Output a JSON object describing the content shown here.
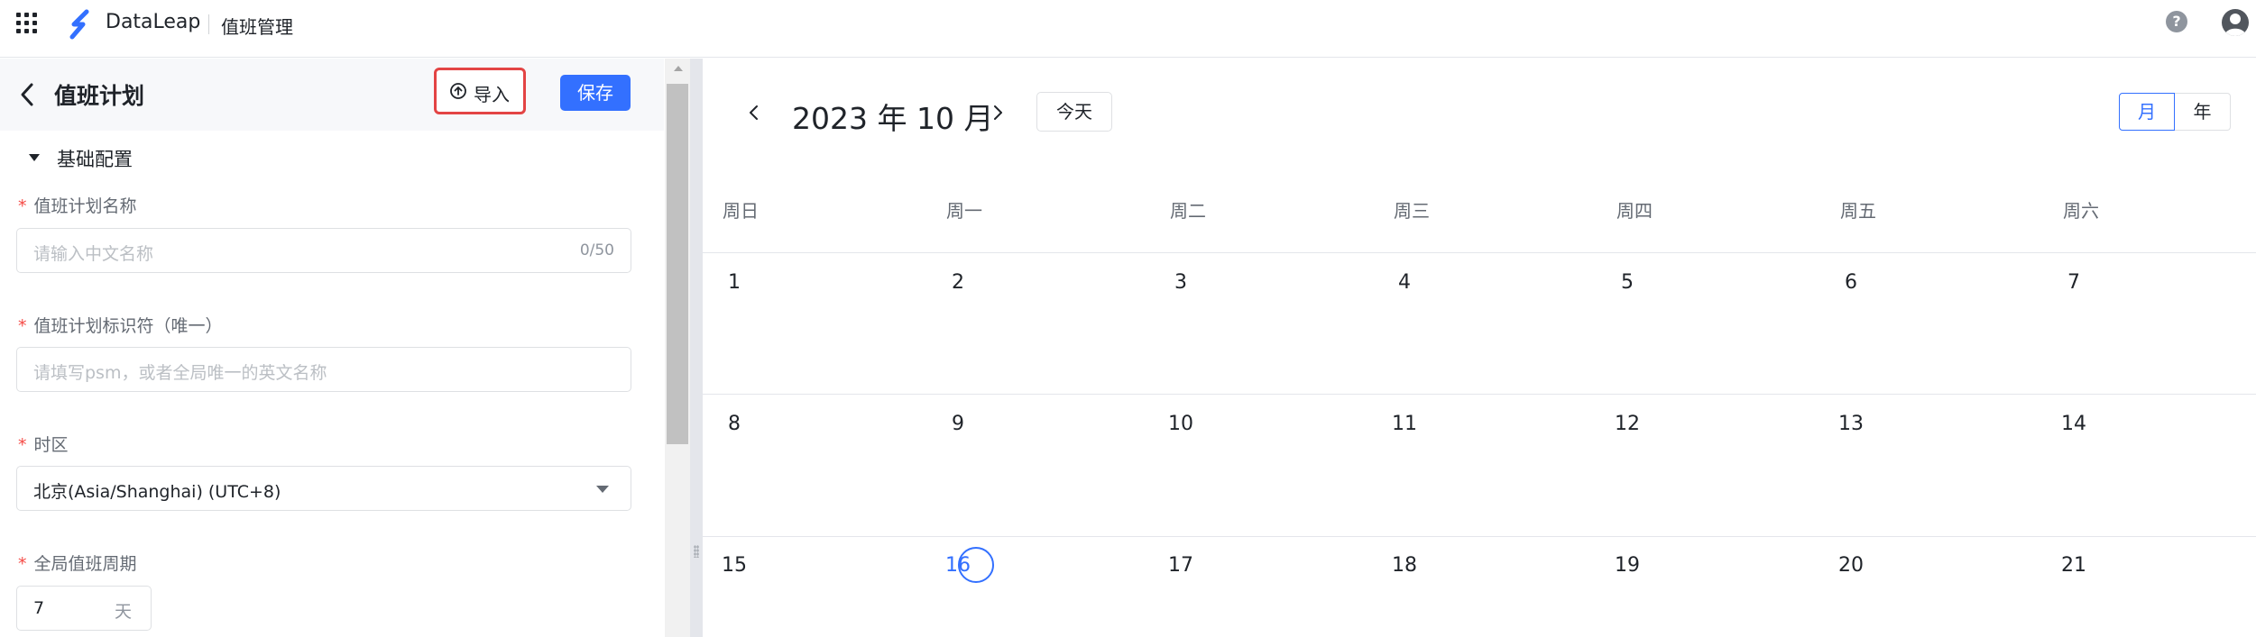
{
  "topbar": {
    "brand": "DataLeap",
    "module": "值班管理",
    "help_glyph": "?"
  },
  "plan": {
    "title": "值班计划",
    "import_label": "导入",
    "save_label": "保存",
    "section_title": "基础配置",
    "fields": {
      "name": {
        "label": "值班计划名称",
        "required_mark": "*",
        "placeholder": "请输入中文名称",
        "count": "0/50"
      },
      "identifier": {
        "label": "值班计划标识符（唯一）",
        "required_mark": "*",
        "placeholder": "请填写psm，或者全局唯一的英文名称"
      },
      "timezone": {
        "label": "时区",
        "required_mark": "*",
        "value": "北京(Asia/Shanghai) (UTC+8)"
      },
      "period": {
        "label": "全局值班周期",
        "required_mark": "*",
        "value": "7",
        "unit": "天"
      }
    }
  },
  "calendar": {
    "title": "2023 年 10 月",
    "today_label": "今天",
    "view_month": "月",
    "view_year": "年",
    "weekdays": [
      "周日",
      "周一",
      "周二",
      "周三",
      "周四",
      "周五",
      "周六"
    ],
    "weeks": [
      [
        "1",
        "2",
        "3",
        "4",
        "5",
        "6",
        "7"
      ],
      [
        "8",
        "9",
        "10",
        "11",
        "12",
        "13",
        "14"
      ],
      [
        "15",
        "16",
        "17",
        "18",
        "19",
        "20",
        "21"
      ]
    ],
    "today": "16"
  },
  "colors": {
    "accent": "#3370ff",
    "required": "#f54a45",
    "highlight_box": "#e34444"
  },
  "icons": [
    "apps-grid-icon",
    "dataleap-logo-icon",
    "help-icon",
    "avatar-icon",
    "back-arrow-icon",
    "upload-circle-icon",
    "caret-down-icon",
    "chevron-left-icon",
    "chevron-right-icon"
  ]
}
